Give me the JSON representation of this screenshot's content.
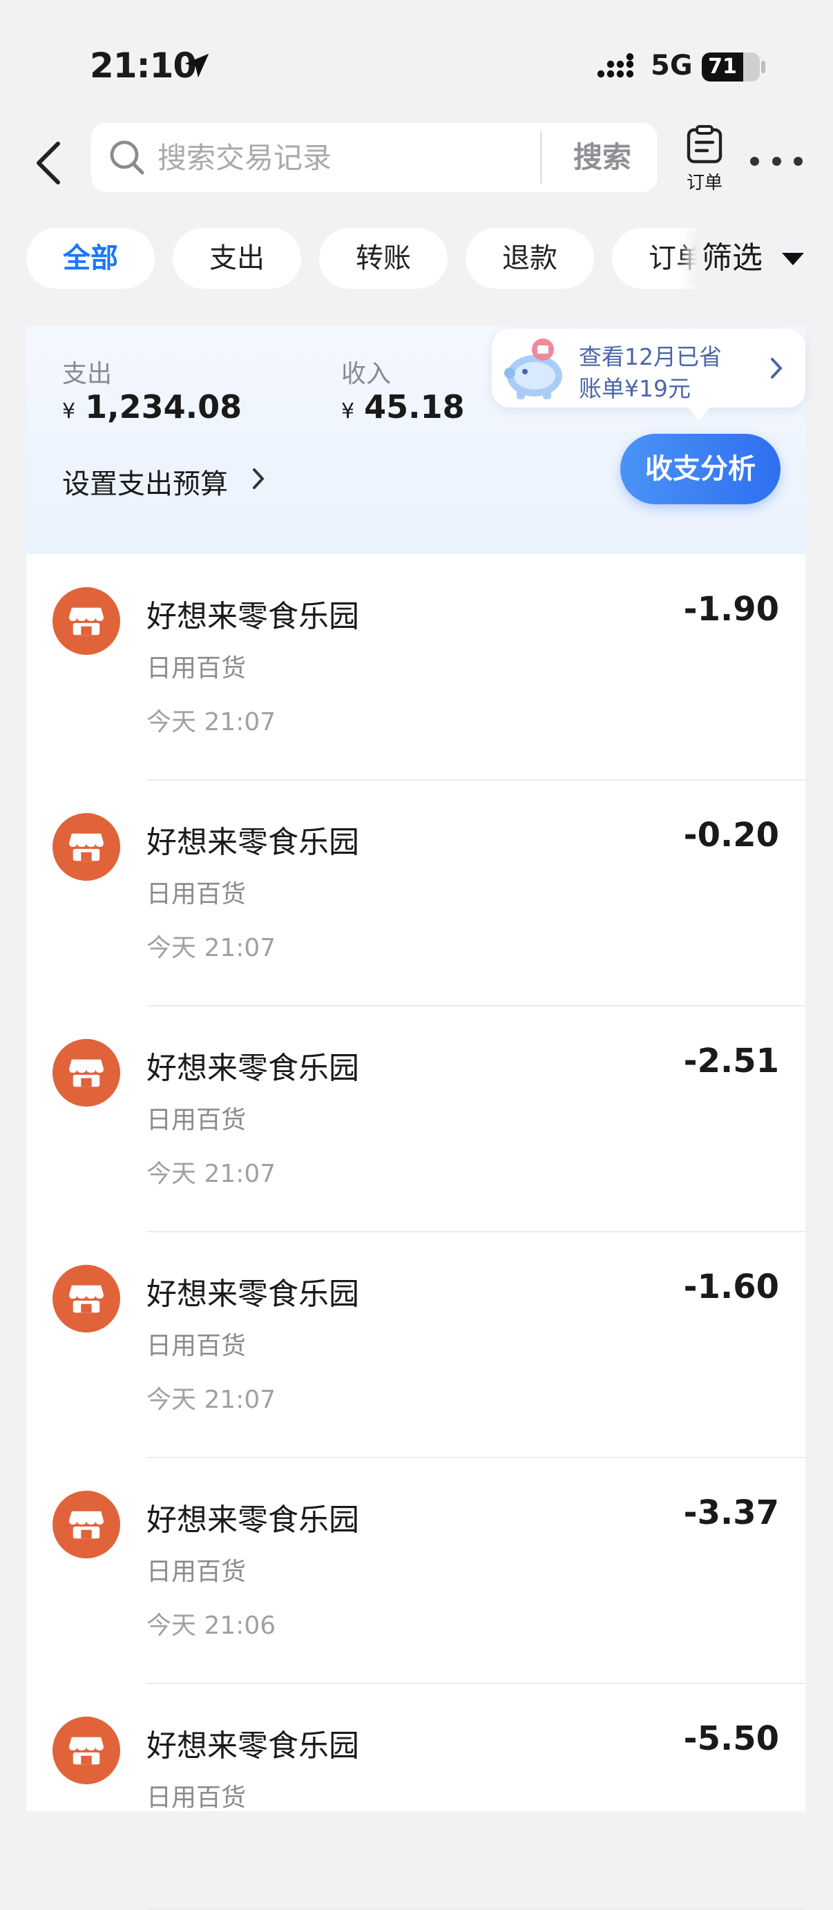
{
  "status_bar": {
    "time": "21:10",
    "network": "5G",
    "battery": "71",
    "battery_level": 0.71
  },
  "search": {
    "placeholder": "搜索交易记录",
    "button": "搜索"
  },
  "header": {
    "orders_label": "订单"
  },
  "tabs": [
    {
      "label": "全部",
      "active": true
    },
    {
      "label": "支出",
      "active": false
    },
    {
      "label": "转账",
      "active": false
    },
    {
      "label": "退款",
      "active": false
    },
    {
      "label": "订单",
      "active": false
    }
  ],
  "filter": {
    "label": "筛选"
  },
  "summary": {
    "expense_label": "支出",
    "expense_currency": "¥",
    "expense_value": "1,234.08",
    "income_label": "收入",
    "income_currency": "¥",
    "income_value": "45.18",
    "promo_line1": "查看12月已省",
    "promo_line2": "账单¥19元",
    "budget_label": "设置支出预算",
    "analysis_button": "收支分析"
  },
  "transactions": [
    {
      "merchant": "好想来零食乐园",
      "category": "日用百货",
      "time": "今天 21:07",
      "amount": "-1.90"
    },
    {
      "merchant": "好想来零食乐园",
      "category": "日用百货",
      "time": "今天 21:07",
      "amount": "-0.20"
    },
    {
      "merchant": "好想来零食乐园",
      "category": "日用百货",
      "time": "今天 21:07",
      "amount": "-2.51"
    },
    {
      "merchant": "好想来零食乐园",
      "category": "日用百货",
      "time": "今天 21:07",
      "amount": "-1.60"
    },
    {
      "merchant": "好想来零食乐园",
      "category": "日用百货",
      "time": "今天 21:06",
      "amount": "-3.37"
    },
    {
      "merchant": "好想来零食乐园",
      "category": "日用百货",
      "time": "",
      "amount": "-5.50"
    }
  ],
  "colors": {
    "accent": "#1677ff",
    "merchant_icon": "#e0633a",
    "page_bg": "#f2f2f4"
  },
  "icons": [
    "location-arrow-icon",
    "signal-icon",
    "search-icon",
    "back-chevron-icon",
    "clipboard-icon",
    "more-dots-icon",
    "caret-down-icon",
    "piggy-bank-icon",
    "chevron-right-icon",
    "shop-icon"
  ]
}
